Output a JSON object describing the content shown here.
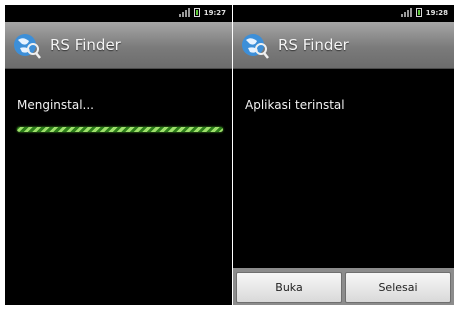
{
  "left_screen": {
    "status": {
      "time": "19:27"
    },
    "appbar": {
      "title": "RS Finder",
      "icon": "rs-finder-globe-icon"
    },
    "message": "Menginstal...",
    "progress": {
      "state": "indeterminate"
    }
  },
  "right_screen": {
    "status": {
      "time": "19:28"
    },
    "appbar": {
      "title": "RS Finder",
      "icon": "rs-finder-globe-icon"
    },
    "message": "Aplikasi terinstal",
    "buttons": {
      "open_label": "Buka",
      "done_label": "Selesai"
    }
  },
  "colors": {
    "appbar": "#7b7b7b",
    "progress_light": "#9de06a",
    "progress_dark": "#2d7f1a",
    "battery": "#5ec83a"
  }
}
